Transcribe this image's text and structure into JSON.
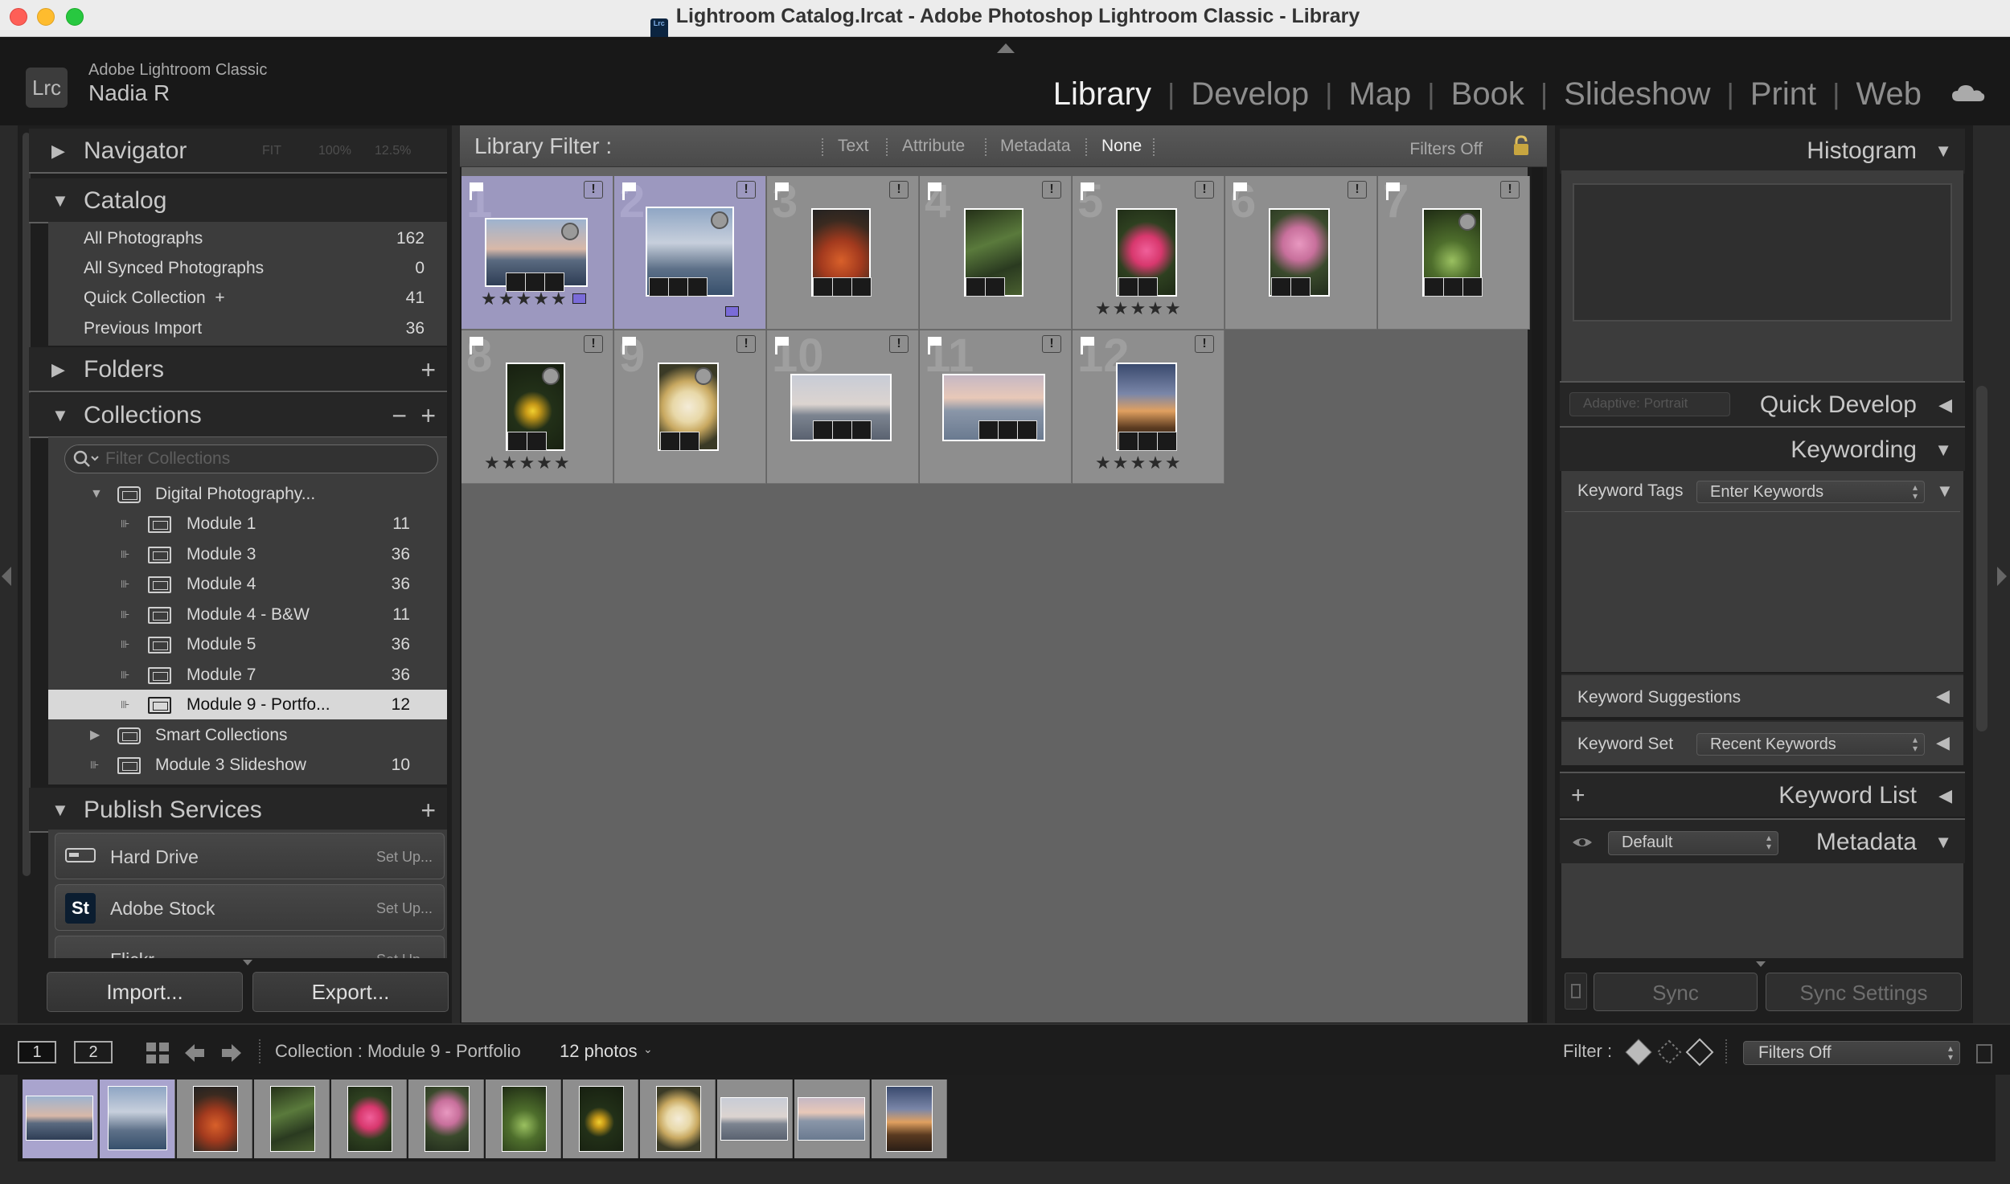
{
  "window": {
    "title": "Lightroom Catalog.lrcat - Adobe Photoshop Lightroom Classic - Library",
    "icon_text": "Lrc"
  },
  "identity": {
    "logo": "Lrc",
    "app_name": "Adobe Lightroom Classic",
    "user": "Nadia R"
  },
  "modules": [
    "Library",
    "Develop",
    "Map",
    "Book",
    "Slideshow",
    "Print",
    "Web"
  ],
  "active_module": "Library",
  "left": {
    "navigator": {
      "title": "Navigator",
      "zoom": [
        "FIT",
        "100%",
        "12.5%"
      ]
    },
    "catalog": {
      "title": "Catalog",
      "items": [
        {
          "label": "All Photographs",
          "count": "162"
        },
        {
          "label": "All Synced Photographs",
          "count": "0"
        },
        {
          "label": "Quick Collection  +",
          "count": "41"
        },
        {
          "label": "Previous Import",
          "count": "36"
        }
      ]
    },
    "folders": {
      "title": "Folders",
      "action": "+"
    },
    "collections": {
      "title": "Collections",
      "actions": [
        "−",
        "+"
      ],
      "search_placeholder": "Filter Collections",
      "set_name": "Digital Photography...",
      "items": [
        {
          "label": "Module 1",
          "count": "11"
        },
        {
          "label": "Module 3",
          "count": "36"
        },
        {
          "label": "Module 4",
          "count": "36"
        },
        {
          "label": "Module 4 - B&W",
          "count": "11"
        },
        {
          "label": "Module 5",
          "count": "36"
        },
        {
          "label": "Module 7",
          "count": "36"
        },
        {
          "label": "Module 9 - Portfo...",
          "count": "12"
        }
      ],
      "smart_collections": "Smart Collections",
      "slideshow": {
        "label": "Module 3 Slideshow",
        "count": "10"
      }
    },
    "publish": {
      "title": "Publish Services",
      "action": "+",
      "services": [
        {
          "icon": "hard-drive-icon",
          "label": "Hard Drive",
          "setup": "Set Up..."
        },
        {
          "icon": "St",
          "label": "Adobe Stock",
          "setup": "Set Up..."
        },
        {
          "icon": "flickr-icon",
          "label": "Flickr",
          "setup": "Set Up..."
        }
      ]
    },
    "import_label": "Import...",
    "export_label": "Export..."
  },
  "filter": {
    "title": "Library Filter :",
    "options": [
      "Text",
      "Attribute",
      "Metadata",
      "None"
    ],
    "selected": "None",
    "status": "Filters Off"
  },
  "photos": [
    {
      "num": "1",
      "stars": "★★★★★",
      "label": "purple",
      "selected": true
    },
    {
      "num": "2",
      "stars": "",
      "label": "purple",
      "selected": true
    },
    {
      "num": "3",
      "stars": "",
      "label": ""
    },
    {
      "num": "4",
      "stars": "",
      "label": ""
    },
    {
      "num": "5",
      "stars": "★★★★★",
      "label": ""
    },
    {
      "num": "6",
      "stars": "",
      "label": ""
    },
    {
      "num": "7",
      "stars": "",
      "label": ""
    },
    {
      "num": "8",
      "stars": "★★★★★",
      "label": ""
    },
    {
      "num": "9",
      "stars": "",
      "label": ""
    },
    {
      "num": "10",
      "stars": "",
      "label": ""
    },
    {
      "num": "11",
      "stars": "",
      "label": ""
    },
    {
      "num": "12",
      "stars": "★★★★★",
      "label": ""
    }
  ],
  "right": {
    "histogram": "Histogram",
    "quick_develop": {
      "title": "Quick Develop",
      "preset": "Adaptive: Portrait"
    },
    "keywording": {
      "title": "Keywording",
      "tags_label": "Keyword Tags",
      "tags_value": "Enter Keywords",
      "suggestions": "Keyword Suggestions",
      "set_label": "Keyword Set",
      "set_value": "Recent Keywords"
    },
    "keyword_list": {
      "title": "Keyword List",
      "action": "+"
    },
    "metadata": {
      "title": "Metadata",
      "preset": "Default"
    },
    "sync": "Sync",
    "sync_settings": "Sync Settings"
  },
  "filmbar": {
    "screen1": "1",
    "screen2": "2",
    "source": "Collection : Module 9 - Portfolio",
    "count": "12 photos",
    "filter_label": "Filter :",
    "filter_value": "Filters Off"
  },
  "colors": {
    "accent_label": "#7a6bd8",
    "selection": "#9c98bf"
  }
}
